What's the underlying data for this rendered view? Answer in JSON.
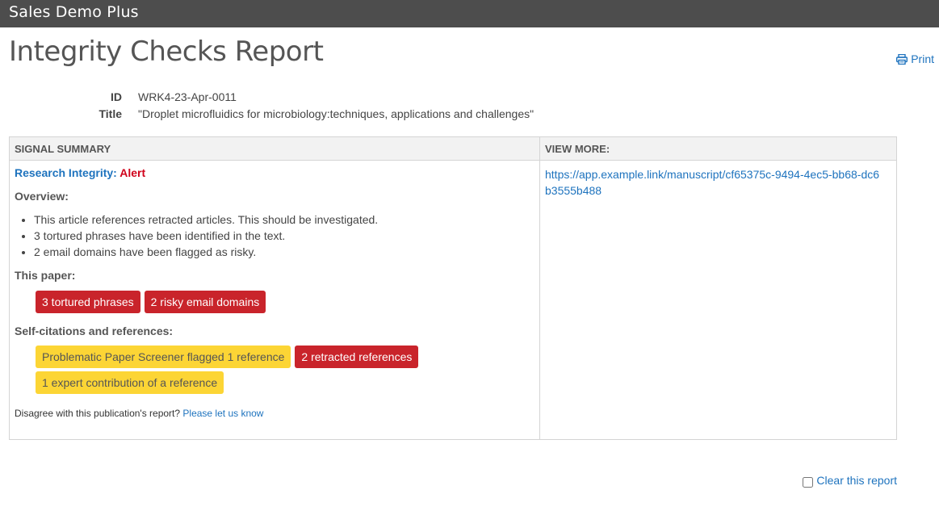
{
  "app": {
    "title": "Sales Demo Plus"
  },
  "page": {
    "title": "Integrity Checks Report",
    "print_label": "Print"
  },
  "meta": {
    "id_label": "ID",
    "id_value": "WRK4-23-Apr-0011",
    "title_label": "Title",
    "title_value": "\"Droplet microfluidics for microbiology:techniques, applications and challenges\""
  },
  "summary": {
    "column_header": "SIGNAL SUMMARY",
    "research_integrity_label": "Research Integrity",
    "research_integrity_sep": ":",
    "research_integrity_status": "Alert",
    "overview_label": "Overview:",
    "overview_items": [
      "This article references retracted articles. This should be investigated.",
      "3 tortured phrases have been identified in the text.",
      "2 email domains have been flagged as risky."
    ],
    "this_paper_label": "This paper:",
    "paper_badges": [
      {
        "label": "3 tortured phrases",
        "color": "#c9242b"
      },
      {
        "label": "2 risky email domains",
        "color": "#c9242b"
      }
    ],
    "refs_label": "Self-citations and references:",
    "refs_badges": [
      {
        "label": "Problematic Paper Screener flagged 1 reference",
        "color": "#fcd535"
      },
      {
        "label": "2 retracted references",
        "color": "#c9242b"
      },
      {
        "label": "1 expert contribution of a reference",
        "color": "#fcd535"
      }
    ],
    "disagree_text": "Disagree with this publication's report?",
    "disagree_link": "Please let us know"
  },
  "view_more": {
    "column_header": "VIEW MORE:",
    "link": "https://app.example.link/manuscript/cf65375c-9494-4ec5-bb68-dc6b3555b488"
  },
  "footer": {
    "clear_label": "Clear this report"
  },
  "icons": {
    "print": "printer-icon"
  },
  "colors": {
    "topbar": "#4d4d4d",
    "link": "#1e73be",
    "alert": "#d0021b",
    "badge_red": "#c9242b",
    "badge_yellow": "#fcd535"
  }
}
